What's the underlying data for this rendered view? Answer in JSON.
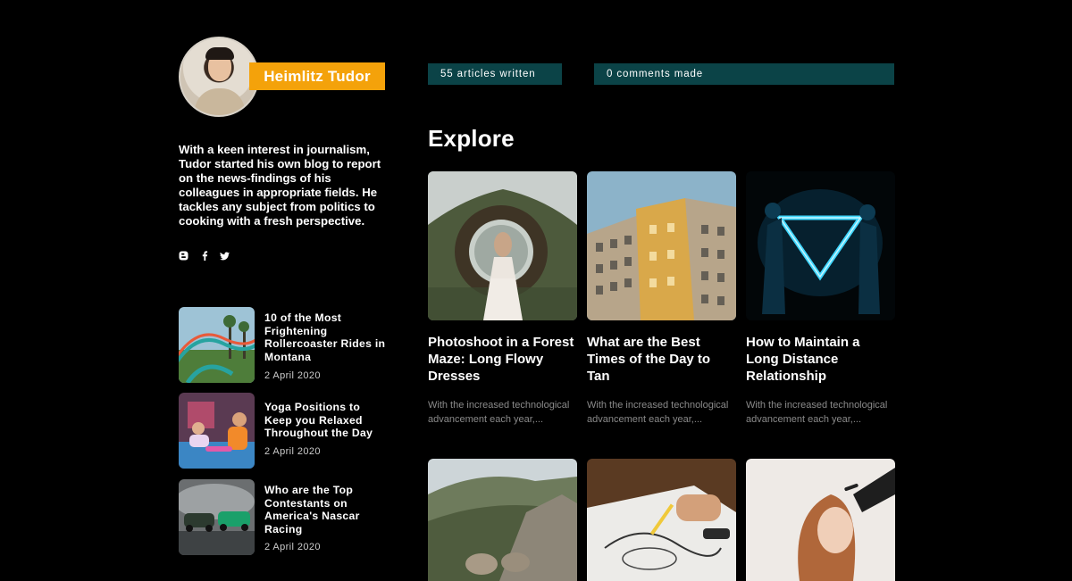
{
  "profile": {
    "name": "Heimlitz Tudor",
    "bio": "With a keen interest in journalism, Tudor started his own blog to report on the news-findings of his colleagues in appropriate fields. He tackles any subject from politics to cooking with a fresh perspective.",
    "socials": [
      "blogger-icon",
      "facebook-icon",
      "twitter-icon"
    ]
  },
  "stats": {
    "articles": "55 articles written",
    "comments": "0 comments made"
  },
  "explore_heading": "Explore",
  "sidebar_posts": [
    {
      "title": "10 of the Most Frightening Rollercoaster Rides in Montana",
      "date": "2 April 2020"
    },
    {
      "title": "Yoga Positions to Keep you Relaxed Throughout the Day",
      "date": "2 April 2020"
    },
    {
      "title": "Who are the Top Contestants on America's Nascar Racing",
      "date": "2 April 2020"
    }
  ],
  "cards": [
    {
      "title": "Photoshoot in a Forest Maze: Long Flowy Dresses",
      "excerpt": "With the increased technological advancement each year,..."
    },
    {
      "title": "What are the Best Times of the Day to Tan",
      "excerpt": "With the increased technological advancement each year,..."
    },
    {
      "title": "How to Maintain a Long Distance Relationship",
      "excerpt": "With the increased technological advancement each year,..."
    }
  ],
  "colors": {
    "accent": "#f4a20a",
    "stat_bg": "#0b4347",
    "background": "#000000",
    "muted": "#8a8a8a"
  }
}
